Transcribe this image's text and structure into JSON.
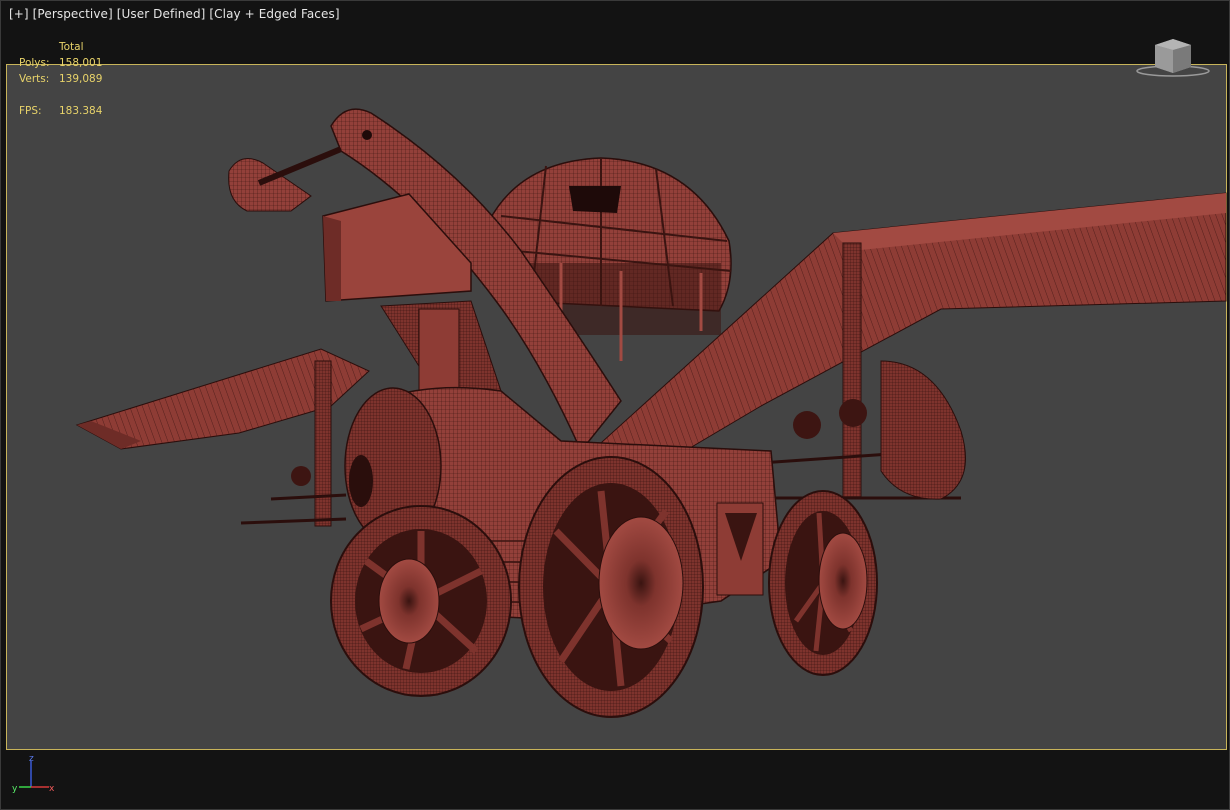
{
  "viewport": {
    "label_parts": [
      "[+]",
      "[Perspective]",
      "[User Defined]",
      "[Clay + Edged Faces]"
    ]
  },
  "stats": {
    "header": "Total",
    "polys_label": "Polys:",
    "polys_value": "158,001",
    "verts_label": "Verts:",
    "verts_value": "139,089",
    "fps_label": "FPS:",
    "fps_value": "183.384"
  },
  "axis": {
    "z": "z",
    "x": "x",
    "y": "y"
  },
  "colors": {
    "background": "#444444",
    "frame": "#c8b45a",
    "clay": "#8a3a33",
    "stats_text": "#e8d36a"
  }
}
